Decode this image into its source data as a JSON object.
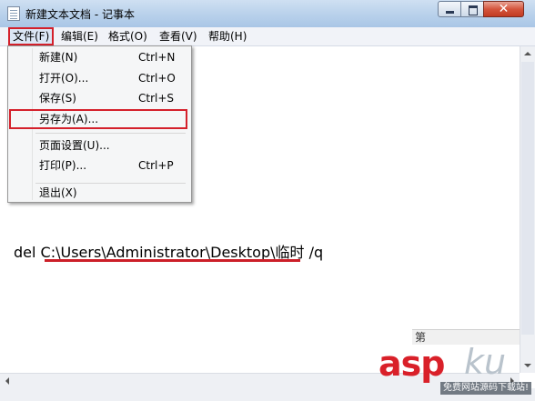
{
  "window": {
    "title": "新建文本文档 - 记事本",
    "close_glyph": "✕"
  },
  "menubar": {
    "file": "文件(F)",
    "edit": "编辑(E)",
    "format": "格式(O)",
    "view": "查看(V)",
    "help": "帮助(H)"
  },
  "file_menu": {
    "new": {
      "label": "新建(N)",
      "shortcut": "Ctrl+N"
    },
    "open": {
      "label": "打开(O)...",
      "shortcut": "Ctrl+O"
    },
    "save": {
      "label": "保存(S)",
      "shortcut": "Ctrl+S"
    },
    "save_as": {
      "label": "另存为(A)..."
    },
    "page_setup": {
      "label": "页面设置(U)..."
    },
    "print": {
      "label": "打印(P)...",
      "shortcut": "Ctrl+P"
    },
    "exit": {
      "label": "退出(X)"
    }
  },
  "editor": {
    "content": "del  C:\\Users\\Administrator\\Desktop\\临时  /q"
  },
  "status": {
    "peek": "第"
  },
  "watermark": {
    "brand_main": "asp",
    "brand_tail": "ku",
    "tagline": "免费网站源码下载站!"
  },
  "colors": {
    "highlight_red": "#d4202b",
    "titlebar": "#bcd3ec",
    "menubar": "#f1f3f8"
  }
}
